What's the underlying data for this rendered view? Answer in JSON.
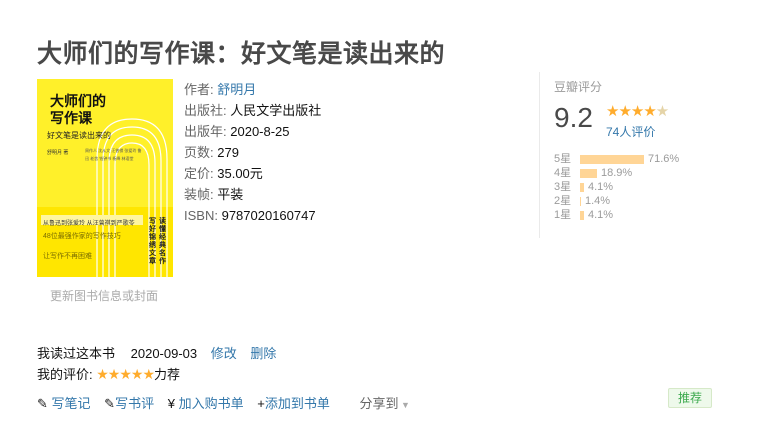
{
  "book": {
    "title": "大师们的写作课：好文笔是读出来的",
    "cover": {
      "title_line1": "大师们的",
      "title_line2": "写作课",
      "subtitle": "好文笔是读出来的",
      "author": "舒明月 著",
      "names": "周作人 沈从文 汪曾祺 张爱玲 鲁迅 老舍 钱钟书 杨绛 林语堂",
      "band": "从鲁迅到张爱玲 从汪曾祺到严歌苓",
      "blurb1": "48位最强作家的写作技巧",
      "blurb2": "让写作不再困难",
      "vertical1": "读懂经典名作",
      "vertical2": "写好锦绣文章"
    },
    "update_link": "更新图书信息或封面",
    "info": [
      {
        "label": "作者:",
        "value": "舒明月",
        "link": true
      },
      {
        "label": "出版社:",
        "value": "人民文学出版社",
        "link": false
      },
      {
        "label": "出版年:",
        "value": "2020-8-25",
        "link": false
      },
      {
        "label": "页数:",
        "value": "279",
        "link": false
      },
      {
        "label": "定价:",
        "value": "35.00元",
        "link": false
      },
      {
        "label": "装帧:",
        "value": "平装",
        "link": false
      },
      {
        "label": "ISBN:",
        "value": "9787020160747",
        "link": false
      }
    ]
  },
  "rating": {
    "header": "豆瓣评分",
    "score": "9.2",
    "stars": "★★★★",
    "half_star": "★",
    "count": "74人评价",
    "distribution": [
      {
        "label": "5星",
        "percent": 71.6,
        "text": "71.6%"
      },
      {
        "label": "4星",
        "percent": 18.9,
        "text": "18.9%"
      },
      {
        "label": "3星",
        "percent": 4.1,
        "text": "4.1%"
      },
      {
        "label": "2星",
        "percent": 1.4,
        "text": "1.4%"
      },
      {
        "label": "1星",
        "percent": 4.1,
        "text": "4.1%"
      }
    ]
  },
  "interest": {
    "status": "我读过这本书",
    "date": "2020-09-03",
    "edit": "修改",
    "delete": "删除",
    "my_rating_label": "我的评价:",
    "my_stars": "★★★★★",
    "my_rating_text": "力荐"
  },
  "actions": {
    "write_note": "写笔记",
    "write_review": "写书评",
    "buy": "加入购书单",
    "add_list": "添加到书单",
    "share": "分享到",
    "recommend": "推荐"
  },
  "colors": {
    "accent": "#3377aa",
    "star": "#ffac2d",
    "cover": "#fff02a"
  }
}
